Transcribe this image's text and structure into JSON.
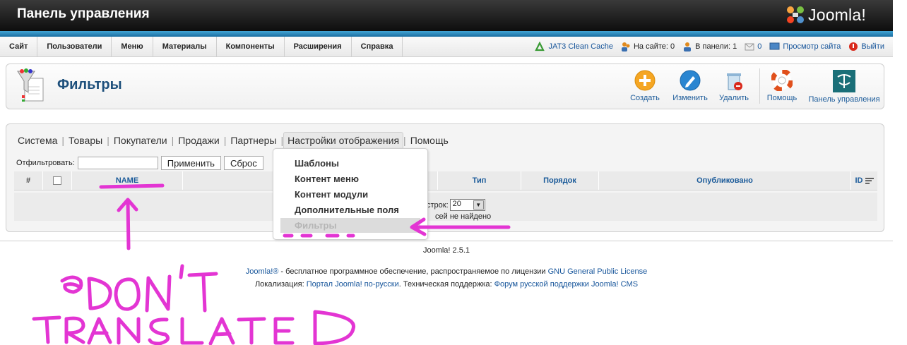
{
  "header": {
    "title": "Панель управления",
    "logo_text": "Joomla!"
  },
  "menu": {
    "items": [
      "Сайт",
      "Пользователи",
      "Меню",
      "Материалы",
      "Компоненты",
      "Расширения",
      "Справка"
    ]
  },
  "status": {
    "cache": "JAT3 Clean Cache",
    "on_site": "На сайте: 0",
    "in_panel": "В панели: 1",
    "messages": "0",
    "view_site": "Просмотр сайта",
    "logout": "Выйти"
  },
  "toolbar": {
    "title": "Фильтры",
    "buttons": {
      "create": "Создать",
      "edit": "Изменить",
      "delete": "Удалить",
      "help": "Помощь",
      "cpanel": "Панель управления"
    }
  },
  "tabs": [
    "Система",
    "Товары",
    "Покупатели",
    "Продажи",
    "Партнеры",
    "Настройки отображения",
    "Помощь"
  ],
  "filter": {
    "label": "Отфильтровать:",
    "value": "",
    "apply": "Применить",
    "reset": "Сброс"
  },
  "grid": {
    "columns": {
      "num": "#",
      "name": "NAME",
      "type": "Тип",
      "order": "Порядок",
      "published": "Опубликовано",
      "id": "ID"
    },
    "rows_label": "строк:",
    "rows_value": "20",
    "empty_message": "сей не найдено"
  },
  "submenu": {
    "items": [
      "Шаблоны",
      "Контент меню",
      "Контент модули",
      "Дополнительные поля",
      "Фильтры"
    ],
    "selected_index": 4
  },
  "footer": {
    "version": "Joomla! 2.5.1",
    "joomla_link": "Joomla!®",
    "license_text": " - бесплатное программное обеспечение, распространяемое по лицензии ",
    "license_link": "GNU General Public License",
    "localization_label": "Локализация: ",
    "localization_link": "Портал Joomla! по-русски",
    "support_label": ". Техническая поддержка: ",
    "support_link": "Форум русской поддержки Joomla! CMS"
  },
  "colors": {
    "header_bg": "#1a1a1a",
    "accent_blue": "#1a6da0",
    "link": "#15549a",
    "annotation": "#e335d3"
  }
}
